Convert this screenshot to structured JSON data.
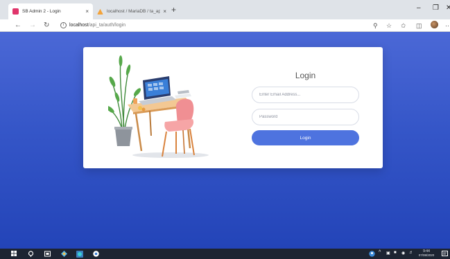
{
  "browser": {
    "tabs": [
      {
        "title": "SB Admin 2 - Login",
        "close": "×"
      },
      {
        "title": "localhost / MariaDB / ta_api / d...",
        "close": "×"
      }
    ],
    "new_tab": "+",
    "address": {
      "host": "localhost",
      "path": "/api_ta/auth/login"
    },
    "window_controls": {
      "minimize": "–",
      "maximize": "❐",
      "close": "✕"
    }
  },
  "login": {
    "title": "Login",
    "email_placeholder": "Enter Email Address...",
    "password_placeholder": "Password",
    "button_label": "Login"
  },
  "taskbar": {
    "time": "9:44",
    "date": "07/08/2020"
  },
  "colors": {
    "page_gradient_top": "#4b68d6",
    "page_gradient_bottom": "#2344b8",
    "primary_button": "#4e73df",
    "card": "#ffffff",
    "taskbar": "#1d2432"
  }
}
